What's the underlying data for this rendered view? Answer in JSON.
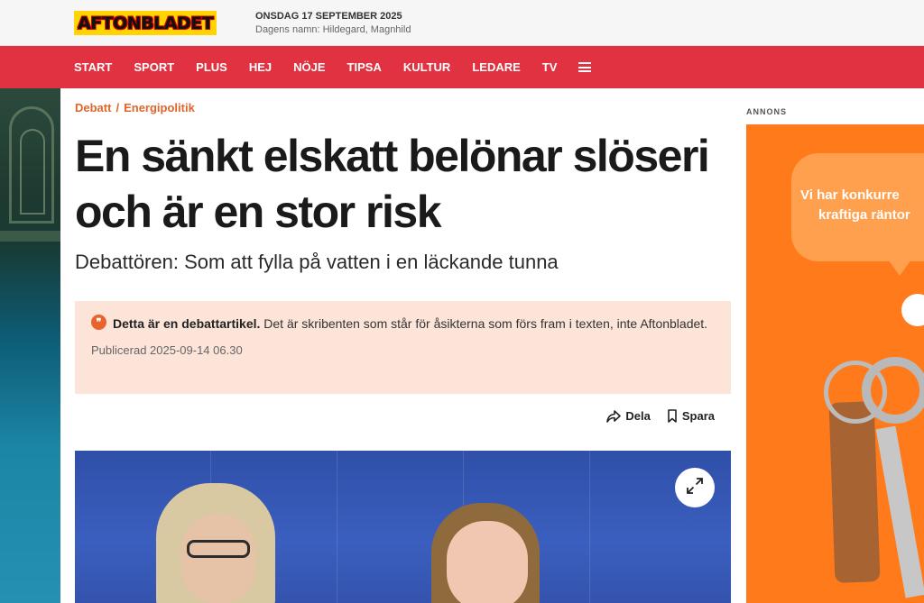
{
  "header": {
    "logo_text": "AFTONBLADET",
    "date": "ONSDAG 17 SEPTEMBER 2025",
    "name_day": "Dagens namn: Hildegard, Magnhild"
  },
  "nav": {
    "items": [
      "START",
      "SPORT",
      "PLUS",
      "HEJ",
      "NÖJE",
      "TIPSA",
      "KULTUR",
      "LEDARE",
      "TV"
    ]
  },
  "article": {
    "breadcrumb": [
      "Debatt",
      "/",
      "Energipolitik"
    ],
    "headline": "En sänkt elskatt belönar slöseri och är en stor risk",
    "subheadline": "Debattören: Som att fylla på vatten i en läckande tunna",
    "debate_notice": {
      "strong": "Detta är en debattartikel.",
      "text": " Det är skribenten som står för åsikterna som förs fram i texten, inte Aftonbladet."
    },
    "published": "Publicerad 2025-09-14 06.30",
    "share_label": "Dela",
    "save_label": "Spara"
  },
  "ad": {
    "label": "ANNONS",
    "bubble_line1": "Vi har konkurre",
    "bubble_line2": "kraftiga räntor"
  },
  "colors": {
    "nav_red": "#e03241",
    "accent_orange": "#e0652a",
    "notice_bg": "#fce4d8",
    "ad_orange": "#ff7a1a"
  }
}
